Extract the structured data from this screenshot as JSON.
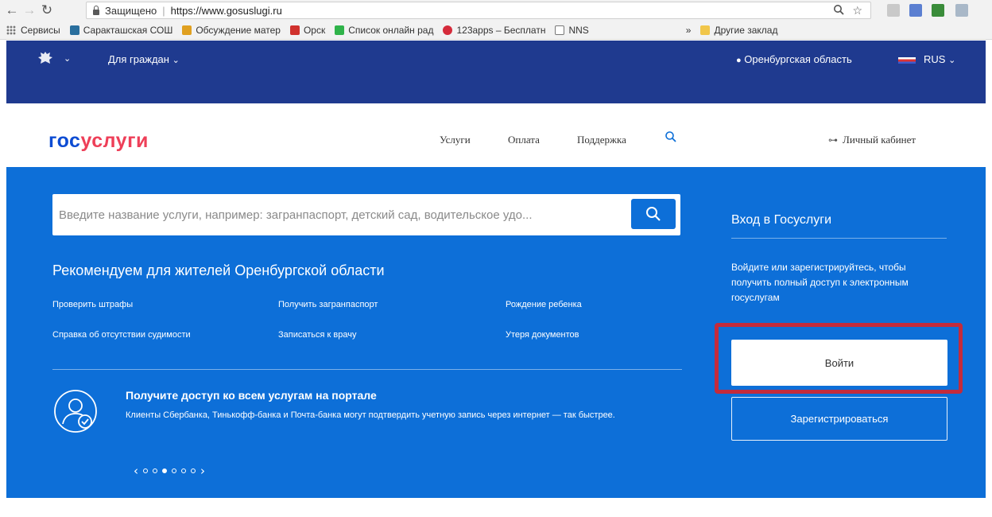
{
  "browser": {
    "security_label": "Защищено",
    "url": "https://www.gosuslugi.ru",
    "bookmarks": [
      {
        "label": "Сервисы",
        "color": "#777777"
      },
      {
        "label": "Саракташская СОШ",
        "color": "#2a6f9e"
      },
      {
        "label": "Обсуждение матер",
        "color": "#e0a020"
      },
      {
        "label": "Орск",
        "color": "#d0312d"
      },
      {
        "label": "Список онлайн рад",
        "color": "#2fb34a"
      },
      {
        "label": "123apps – Бесплатн",
        "color": "#d52b3b"
      },
      {
        "label": "NNS",
        "color": "#777777"
      }
    ],
    "bookmarks_overflow": "»",
    "other_bookmarks": "Другие заклад"
  },
  "topbar": {
    "category": "Для граждан",
    "region": "Оренбургская область",
    "language": "RUS"
  },
  "header": {
    "logo_part1": "гос",
    "logo_part2": "услуги",
    "nav": [
      "Услуги",
      "Оплата",
      "Поддержка"
    ],
    "cabinet": "Личный кабинет"
  },
  "hero": {
    "search_placeholder": "Введите название услуги, например: загранпаспорт, детский сад, водительское удо...",
    "recommend_title": "Рекомендуем для жителей Оренбургской области",
    "links": [
      "Проверить штрафы",
      "Получить загранпаспорт",
      "Рождение ребенка",
      "Справка об отсутствии судимости",
      "Записаться к врачу",
      "Утеря документов"
    ],
    "promo_title": "Получите доступ ко всем услугам на портале",
    "promo_text": "Клиенты Сбербанка, Тинькофф-банка и Почта-банка могут подтвердить учетную запись через интернет — так быстрее.",
    "carousel": {
      "total": 6,
      "active": 3
    }
  },
  "login": {
    "title": "Вход в Госуслуги",
    "text": "Войдите или зарегистрируйтесь, чтобы получить полный доступ к электронным госуслугам",
    "login_button": "Войти",
    "register_button": "Зарегистрироваться"
  },
  "colors": {
    "hero_blue": "#0d6fd8",
    "topbar_navy": "#1f3a8f",
    "logo_blue": "#0d4cd3",
    "logo_red": "#ee3f58",
    "highlight_red": "#c32b3c"
  }
}
